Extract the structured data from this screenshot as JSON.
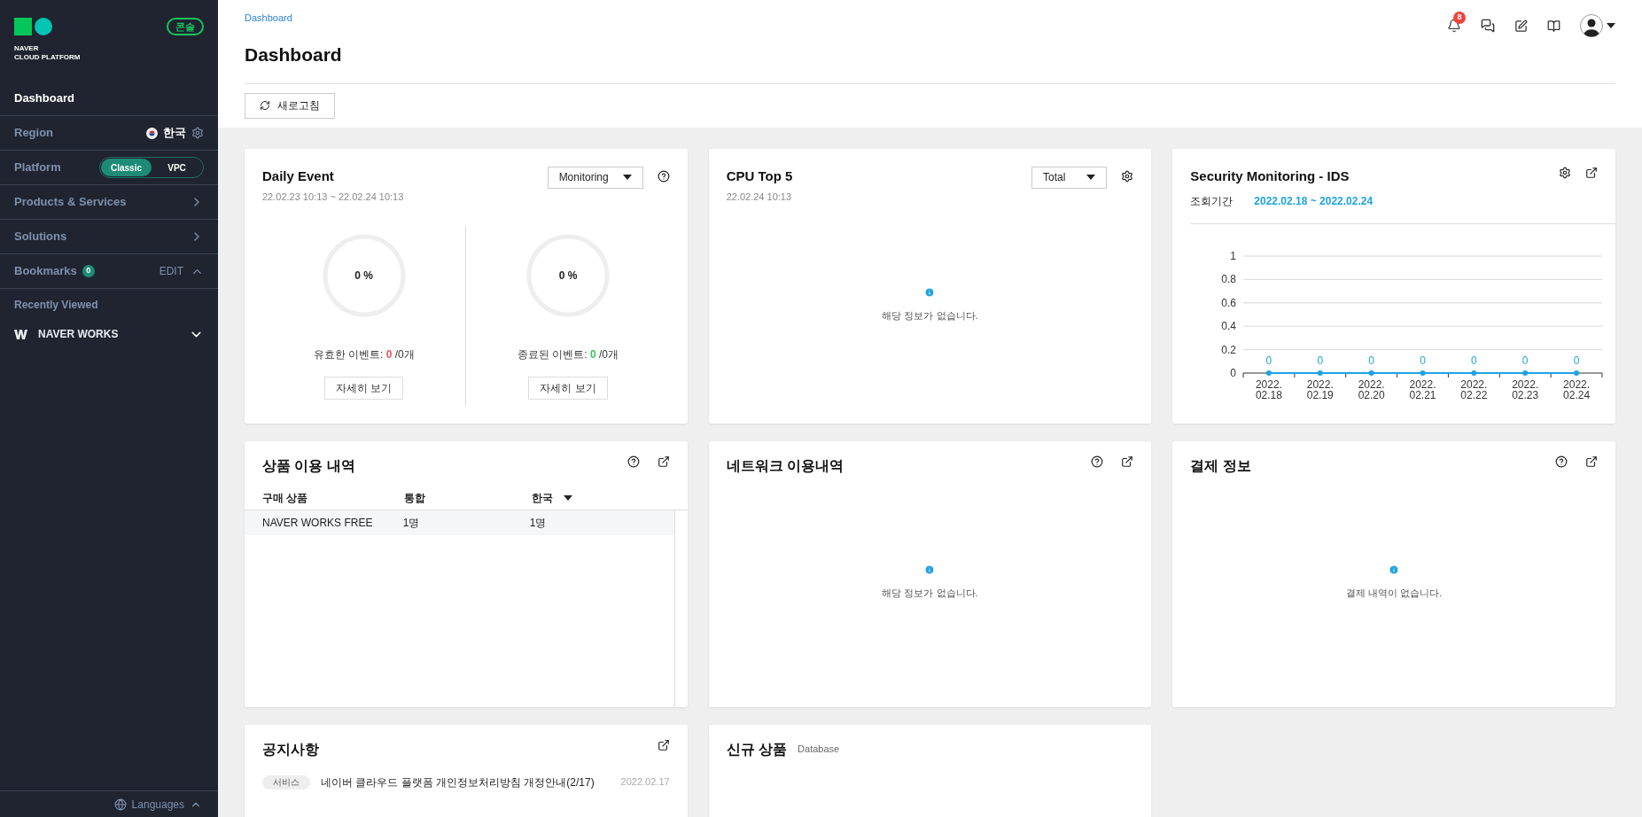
{
  "sidebar": {
    "logo": {
      "line1": "NAVER",
      "line2": "CLOUD PLATFORM"
    },
    "badge": "콘솔",
    "items": [
      {
        "kind": "link",
        "label": "Dashboard",
        "selected": true
      },
      {
        "kind": "region",
        "label": "Region",
        "value": "한국"
      },
      {
        "kind": "platform",
        "label": "Platform",
        "options": [
          {
            "label": "Classic",
            "selected": true
          },
          {
            "label": "VPC",
            "selected": false
          }
        ]
      },
      {
        "kind": "nav",
        "label": "Products & Services",
        "selected": false
      },
      {
        "kind": "nav",
        "label": "Solutions",
        "selected": false
      },
      {
        "kind": "bookmarks",
        "label": "Bookmarks",
        "count": "0",
        "action": "EDIT",
        "expanded": true
      },
      {
        "kind": "section",
        "label": "Recently Viewed"
      },
      {
        "kind": "recent",
        "label": "NAVER WORKS",
        "expanded": false
      }
    ],
    "languages": "Languages"
  },
  "header": {
    "breadcrumb": "Dashboard",
    "title": "Dashboard",
    "notification_count": "8",
    "refresh": "새로고침"
  },
  "daily_event": {
    "title": "Daily Event",
    "range": "22.02.23 10:13 ~ 22.02.24 10:13",
    "filter": "Monitoring",
    "gauges": [
      {
        "percent": "0 %",
        "label": "유효한 이벤트: ",
        "count": "0",
        "total": " /0개",
        "color": "#f0555a",
        "button": "자세히 보기"
      },
      {
        "percent": "0 %",
        "label": "종료된 이벤트: ",
        "count": "0",
        "total": " /0개",
        "color": "#3cc35a",
        "button": "자세히 보기"
      }
    ]
  },
  "cpu_top5": {
    "title": "CPU Top 5",
    "time": "22.02.24 10:13",
    "filter": "Total",
    "empty": "해당 정보가 없습니다."
  },
  "security": {
    "title": "Security Monitoring - IDS",
    "period_label": "조회기간",
    "period": "2022.02.18 ~ 2022.02.24",
    "chart_data": {
      "type": "line",
      "categories": [
        "2022. 02.18",
        "2022. 02.19",
        "2022. 02.20",
        "2022. 02.21",
        "2022. 02.22",
        "2022. 02.23",
        "2022. 02.24"
      ],
      "series": [
        {
          "color": "#1fa3e0",
          "marker": true,
          "values": [
            0,
            0,
            0,
            0,
            0,
            0,
            0
          ]
        }
      ],
      "grid": true,
      "ylim": [
        0,
        1
      ],
      "yticks": [
        0,
        0.2,
        0.4,
        0.6,
        0.8,
        1
      ],
      "data_labels": true
    }
  },
  "product_usage": {
    "title": "상품 이용 내역",
    "columns": [
      "구매 상품",
      "통합",
      "한국"
    ],
    "rows": [
      {
        "cells": [
          "NAVER WORKS FREE",
          "1명",
          "1명"
        ]
      }
    ]
  },
  "network": {
    "title": "네트워크 이용내역",
    "empty": "해당 정보가 없습니다."
  },
  "payment": {
    "title": "결제 정보",
    "empty": "결제 내역이 없습니다."
  },
  "notices": {
    "title": "공지사항",
    "items": [
      {
        "tag": "서비스",
        "text": "네이버 클라우드 플랫폼 개인정보처리방침 개정안내(2/17)",
        "date": "2022.02.17"
      }
    ]
  },
  "new_products": {
    "title": "신규 상품",
    "category": "Database"
  }
}
